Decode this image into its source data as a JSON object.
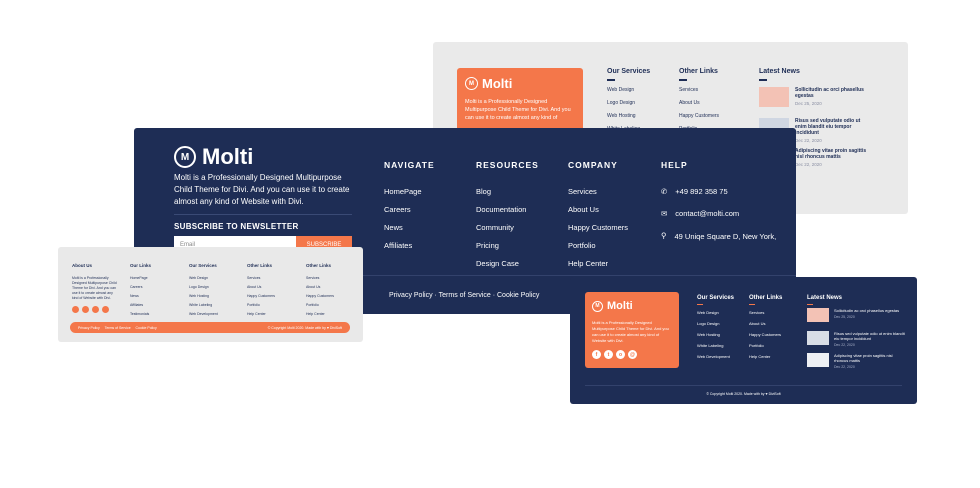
{
  "brand": {
    "name": "Molti",
    "mark": "M"
  },
  "colors": {
    "navy": "#1e2d55",
    "accent": "#f4774a",
    "light": "#eaeaea"
  },
  "cardA": {
    "desc": "Molti is a Professionally Designed Multipurpose Child Theme for Divi. And you can use it to create almost any kind of",
    "services": {
      "title": "Our Services",
      "items": [
        "Web Design",
        "Logo Design",
        "Web Hosting",
        "White Labeling"
      ]
    },
    "other": {
      "title": "Other Links",
      "items": [
        "Services",
        "About Us",
        "Happy Customers",
        "Portfolio"
      ]
    },
    "news": {
      "title": "Latest News",
      "items": [
        {
          "title": "Sollicitudin ac orci phasellus egestas",
          "date": "Dec 25, 2020"
        },
        {
          "title": "Risus sed vulputate odio ut enim blandit eiu tempor incididunt",
          "date": "Dec 22, 2020"
        },
        {
          "title": "Adipiscing vitae proin sagittis nisl rhoncus mattis",
          "date": "Dec 22, 2020"
        }
      ]
    }
  },
  "cardB": {
    "desc": "Molti is a Professionally Designed Multipurpose Child Theme for Divi. And you can use it to create almost any kind of Website with Divi.",
    "newsletter": "SUBSCRIBE TO NEWSLETTER",
    "email_placeholder": "Email",
    "subscribe": "SUBSCRIBE",
    "navigate": {
      "title": "NAVIGATE",
      "items": [
        "HomePage",
        "Careers",
        "News",
        "Affiliates"
      ]
    },
    "resources": {
      "title": "RESOURCES",
      "items": [
        "Blog",
        "Documentation",
        "Community",
        "Pricing",
        "Design Case"
      ]
    },
    "company": {
      "title": "COMPANY",
      "items": [
        "Services",
        "About Us",
        "Happy Customers",
        "Portfolio",
        "Help Center"
      ]
    },
    "help": {
      "title": "HELP",
      "phone": "+49 892 358 75",
      "email": "contact@molti.com",
      "address": "49 Uniqe Square D, New York,"
    },
    "policy": "Privacy Policy · Terms of Service · Cookie Policy"
  },
  "cardC": {
    "about": {
      "title": "About Us",
      "text": "Molti is a Professionally Designed Multipurpose Child Theme for Divi. And you can use it to create almost any kind of Website with Divi."
    },
    "links": {
      "title": "Our Links",
      "items": [
        "HomePage",
        "Careers",
        "News",
        "Affiliates",
        "Testimonials"
      ]
    },
    "services": {
      "title": "Our Services",
      "items": [
        "Web Design",
        "Logo Design",
        "Web Hosting",
        "White Labeling",
        "Web Development"
      ]
    },
    "other": {
      "title": "Other Links",
      "items": [
        "Services",
        "About Us",
        "Happy Customers",
        "Portfolio",
        "Help Center"
      ]
    },
    "other2": {
      "title": "Other Links",
      "items": [
        "Services",
        "About Us",
        "Happy Customers",
        "Portfolio",
        "Help Center"
      ]
    },
    "policy": "Privacy Policy     Terms of Service     Cookie Policy",
    "copyright": "© Copyright Molti 2020. Made with by ♥ DiviSoft"
  },
  "cardD": {
    "desc": "Molti is a Professionally Designed Multipurpose Child Theme for Divi. And you can use it to create almost any kind of Website with Divi.",
    "services": {
      "title": "Our Services",
      "items": [
        "Web Design",
        "Logo Design",
        "Web Hosting",
        "White Labeling",
        "Web Development"
      ]
    },
    "other": {
      "title": "Other Links",
      "items": [
        "Services",
        "About Us",
        "Happy Customers",
        "Portfolio",
        "Help Center"
      ]
    },
    "news": {
      "title": "Latest News",
      "items": [
        {
          "title": "Sollicitudin ac orci phasellus egestas",
          "date": "Dec 25, 2020"
        },
        {
          "title": "Risus sed vulputate odio ut enim blandit eiu tempor incididunt",
          "date": "Dec 22, 2020"
        },
        {
          "title": "Adipiscing vitae proin sagittis nisl rhoncus mattis",
          "date": "Dec 22, 2020"
        }
      ]
    },
    "copyright": "© Copyright Molti 2020. Made with by ♥ DiviSoft"
  }
}
